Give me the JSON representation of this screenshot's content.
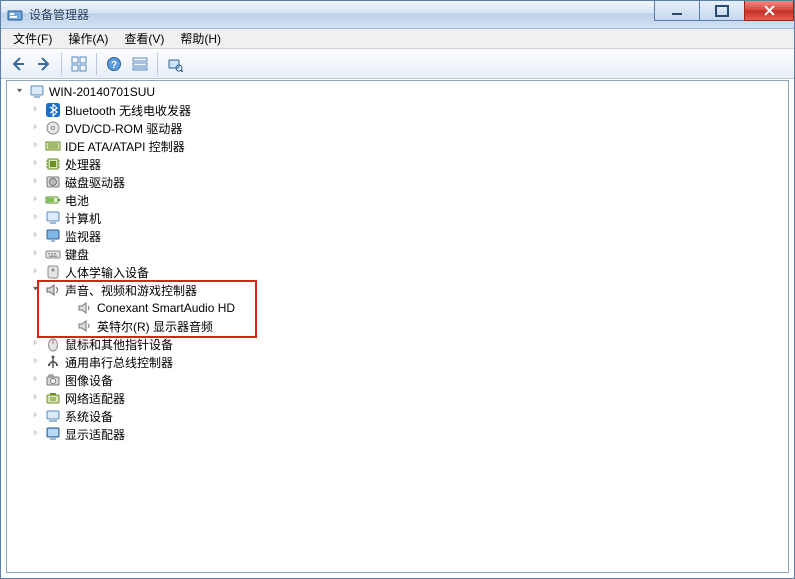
{
  "window": {
    "title": "设备管理器"
  },
  "menubar": {
    "file": "文件(F)",
    "action": "操作(A)",
    "view": "查看(V)",
    "help": "帮助(H)"
  },
  "toolbar": {
    "back": "后退",
    "forward": "前进",
    "show_hidden": "显示隐藏的设备",
    "properties": "属性",
    "help": "帮助",
    "view_by": "查看方式",
    "scan": "扫描检测硬件改动"
  },
  "tree": {
    "root": "WIN-20140701SUU",
    "items": [
      {
        "label": "Bluetooth 无线电收发器",
        "icon": "bluetooth"
      },
      {
        "label": "DVD/CD-ROM 驱动器",
        "icon": "disc"
      },
      {
        "label": "IDE ATA/ATAPI 控制器",
        "icon": "ide"
      },
      {
        "label": "处理器",
        "icon": "cpu"
      },
      {
        "label": "磁盘驱动器",
        "icon": "disk"
      },
      {
        "label": "电池",
        "icon": "battery"
      },
      {
        "label": "计算机",
        "icon": "computer"
      },
      {
        "label": "监视器",
        "icon": "monitor"
      },
      {
        "label": "键盘",
        "icon": "keyboard"
      },
      {
        "label": "人体学输入设备",
        "icon": "hid"
      },
      {
        "label": "声音、视频和游戏控制器",
        "icon": "sound",
        "expanded": true,
        "children": [
          {
            "label": "Conexant SmartAudio HD",
            "icon": "speaker"
          },
          {
            "label": "英特尔(R) 显示器音频",
            "icon": "speaker"
          }
        ]
      },
      {
        "label": "鼠标和其他指针设备",
        "icon": "mouse"
      },
      {
        "label": "通用串行总线控制器",
        "icon": "usb"
      },
      {
        "label": "图像设备",
        "icon": "camera"
      },
      {
        "label": "网络适配器",
        "icon": "network"
      },
      {
        "label": "系统设备",
        "icon": "system"
      },
      {
        "label": "显示适配器",
        "icon": "display"
      }
    ]
  }
}
